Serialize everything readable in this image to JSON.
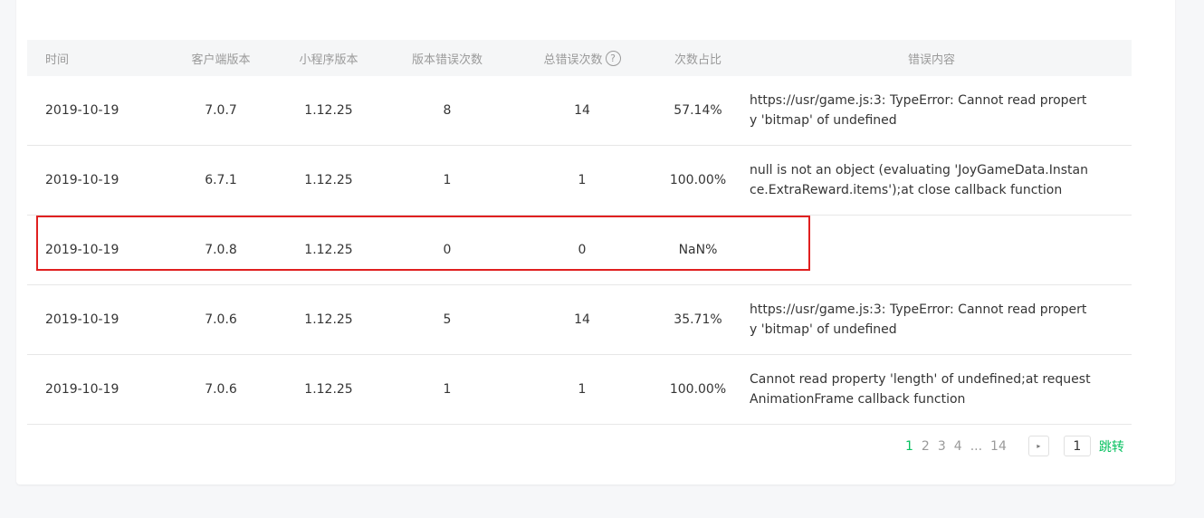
{
  "table": {
    "headers": {
      "date": "时间",
      "client_version": "客户端版本",
      "mini_version": "小程序版本",
      "version_errors": "版本错误次数",
      "total_errors": "总错误次数",
      "ratio": "次数占比",
      "message": "错误内容"
    },
    "help_icon": "question-circle-icon",
    "help_glyph": "?",
    "rows": [
      {
        "date": "2019-10-19",
        "client": "7.0.7",
        "mini": "1.12.25",
        "verr": "8",
        "terr": "14",
        "ratio": "57.14%",
        "msg": "https://usr/game.js:3: TypeError: Cannot read property 'bitmap' of undefined"
      },
      {
        "date": "2019-10-19",
        "client": "6.7.1",
        "mini": "1.12.25",
        "verr": "1",
        "terr": "1",
        "ratio": "100.00%",
        "msg": "null is not an object (evaluating 'JoyGameData.Instance.ExtraReward.items');at close callback function"
      },
      {
        "date": "2019-10-19",
        "client": "7.0.8",
        "mini": "1.12.25",
        "verr": "0",
        "terr": "0",
        "ratio": "NaN%",
        "msg": ""
      },
      {
        "date": "2019-10-19",
        "client": "7.0.6",
        "mini": "1.12.25",
        "verr": "5",
        "terr": "14",
        "ratio": "35.71%",
        "msg": "https://usr/game.js:3: TypeError: Cannot read property 'bitmap' of undefined"
      },
      {
        "date": "2019-10-19",
        "client": "7.0.6",
        "mini": "1.12.25",
        "verr": "1",
        "terr": "1",
        "ratio": "100.00%",
        "msg": "Cannot read property 'length' of undefined;at requestAnimationFrame callback function"
      }
    ]
  },
  "pagination": {
    "pages": [
      "1",
      "2",
      "3",
      "4"
    ],
    "ellipsis": "...",
    "last_page": "14",
    "current": "1",
    "next_icon": "caret-right-icon",
    "next_glyph": "▸",
    "input_value": "1",
    "jump_label": "跳转"
  },
  "colors": {
    "accent": "#07c160",
    "highlight_border": "#e02020",
    "header_bg": "#f5f6f7",
    "page_bg": "#f6f7f9"
  }
}
